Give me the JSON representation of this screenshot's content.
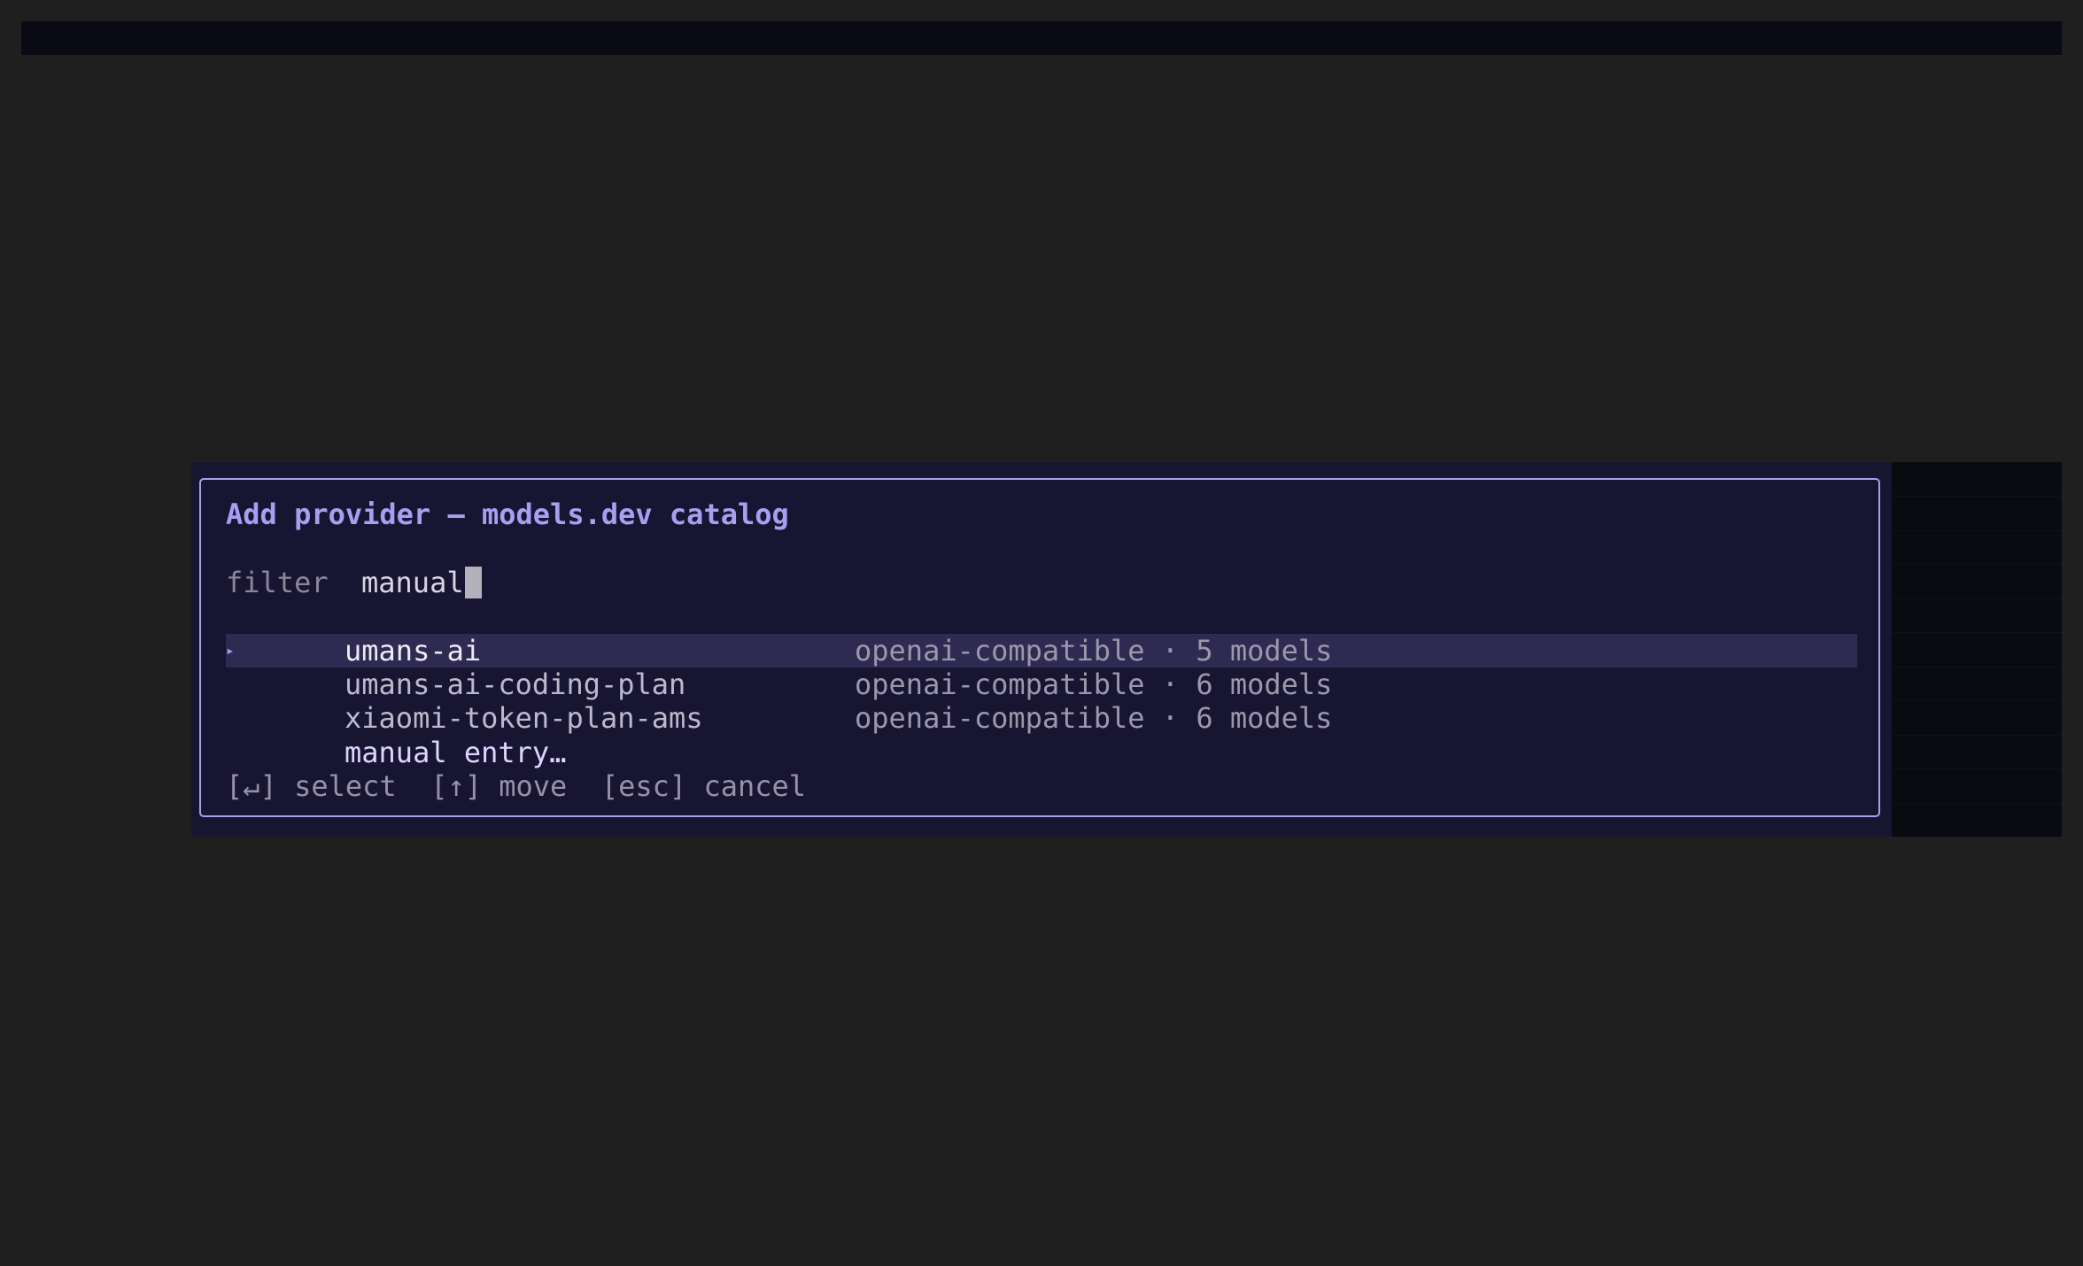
{
  "dialog": {
    "title": "Add provider — models.dev catalog",
    "filter_label": "filter",
    "filter_value": "manual",
    "selected_marker": "▸",
    "items": [
      {
        "name": "umans-ai",
        "meta": "openai-compatible · 5 models",
        "selected": true
      },
      {
        "name": "umans-ai-coding-plan",
        "meta": "openai-compatible · 6 models",
        "selected": false
      },
      {
        "name": "xiaomi-token-plan-ams",
        "meta": "openai-compatible · 6 models",
        "selected": false
      }
    ],
    "manual_entry_label": "manual entry…",
    "help_text": "[↵] select  [↑] move  [esc] cancel"
  },
  "colors": {
    "background": "#1f1f1f",
    "dialog_background": "#181533",
    "border": "#a8a0e8",
    "accent": "#a99ef0",
    "selected_row": "#2f2a52"
  }
}
